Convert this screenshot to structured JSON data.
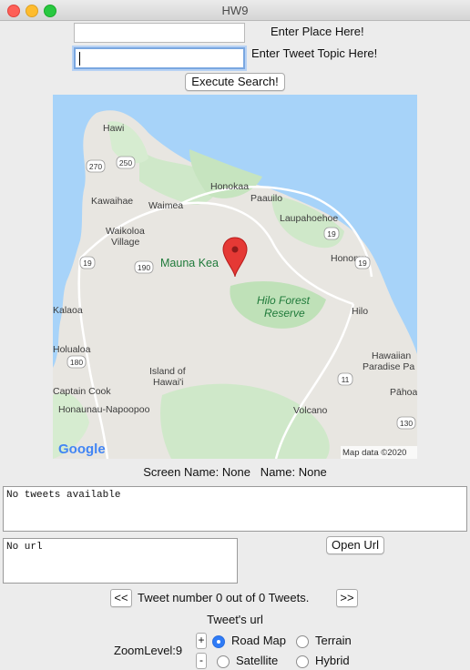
{
  "window": {
    "title": "HW9"
  },
  "search": {
    "place_label": "Enter Place Here!",
    "place_value": "",
    "topic_label": "Enter Tweet Topic Here!",
    "topic_value": "",
    "execute_label": "Execute Search!"
  },
  "map": {
    "labels": {
      "hawi": "Hawi",
      "honokaa": "Honokaa",
      "paauilo": "Paauilo",
      "kawaihae": "Kawaihae",
      "waimea": "Waimea",
      "laupahoehoe": "Laupahoehoe",
      "waikoloa": "Waikoloa",
      "village": "Village",
      "honomu": "Honomu",
      "mauna_kea": "Mauna Kea",
      "hilo_forest": "Hilo Forest",
      "reserve": "Reserve",
      "hilo": "Hilo",
      "kalaoa": "Kalaoa",
      "holualoa": "Holualoa",
      "island_of": "Island of",
      "hawaii": "Hawai'i",
      "hawaiian": "Hawaiian",
      "paradise_park": "Paradise Pa",
      "captain_cook": "Captain Cook",
      "pahoa": "Pāhoa",
      "honaunau": "Honaunau-Napoopoo",
      "volcano": "Volcano",
      "google": "Google",
      "attribution": "Map data ©2020"
    },
    "shields": [
      "270",
      "250",
      "19",
      "19",
      "190",
      "19",
      "180",
      "11",
      "130"
    ]
  },
  "tweet": {
    "screen_name_text": "Screen Name: None   Name: None",
    "tweet_text": "No tweets available",
    "url_text": "No url",
    "open_url_label": "Open Url",
    "prev_label": "<<",
    "next_label": ">>",
    "counter_text": "Tweet number 0 out of 0 Tweets.",
    "url_caption": "Tweet's url"
  },
  "controls": {
    "zoom_label": "ZoomLevel:9",
    "zoom_in_label": "+",
    "zoom_out_label": "-",
    "map_types": [
      {
        "label": "Road Map",
        "selected": true
      },
      {
        "label": "Terrain",
        "selected": false
      },
      {
        "label": "Satellite",
        "selected": false
      },
      {
        "label": "Hybrid",
        "selected": false
      }
    ]
  }
}
